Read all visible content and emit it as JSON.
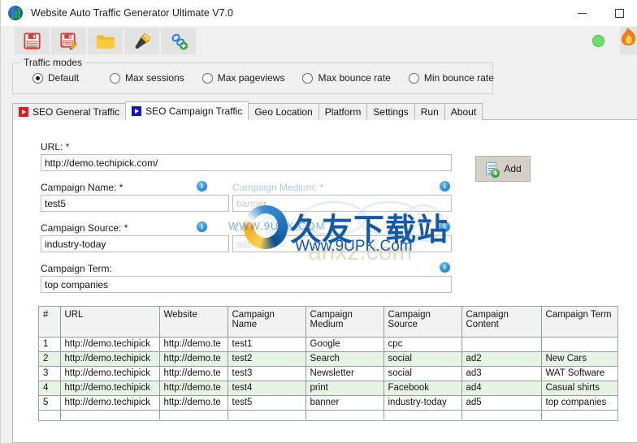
{
  "window": {
    "title": "Website Auto Traffic Generator Ultimate V7.0",
    "app_icon": "globe-chart-icon",
    "controls": {
      "minimize": "minimize-icon",
      "maximize": "maximize-icon"
    }
  },
  "toolbar": {
    "buttons": [
      {
        "name": "save-button",
        "icon": "floppy-disk-icon"
      },
      {
        "name": "save-as-button",
        "icon": "floppy-disk-edit-icon"
      },
      {
        "name": "open-button",
        "icon": "folder-icon"
      },
      {
        "name": "tools-button",
        "icon": "flashlight-icon"
      },
      {
        "name": "add-link-button",
        "icon": "link-add-icon"
      }
    ],
    "status_indicator": "green-status-dot",
    "status_color": "#6ede6e",
    "tray_icon": "orange-app-icon"
  },
  "traffic_modes": {
    "legend": "Traffic modes",
    "options": [
      {
        "label": "Default",
        "checked": true
      },
      {
        "label": "Max sessions",
        "checked": false
      },
      {
        "label": "Max pageviews",
        "checked": false
      },
      {
        "label": "Max bounce rate",
        "checked": false
      },
      {
        "label": "Min bounce rate",
        "checked": false
      }
    ]
  },
  "tabs": [
    {
      "label": "SEO General Traffic",
      "icon": "play-icon",
      "icon_color": "#e01b1b",
      "active": false
    },
    {
      "label": "SEO Campaign Traffic",
      "icon": "play-icon",
      "icon_color": "#1414c8",
      "active": true
    },
    {
      "label": "Geo Location",
      "active": false
    },
    {
      "label": "Platform",
      "active": false
    },
    {
      "label": "Settings",
      "active": false
    },
    {
      "label": "Run",
      "active": false
    },
    {
      "label": "About",
      "active": false
    }
  ],
  "form": {
    "url": {
      "label": "URL: *",
      "value": "http://demo.techipick.com/"
    },
    "campaign_name": {
      "label": "Campaign Name: *",
      "value": "test5",
      "info": "i"
    },
    "campaign_medium": {
      "label": "Campaign Medium: *",
      "value": "banner",
      "info": "i"
    },
    "campaign_source": {
      "label": "Campaign Source: *",
      "value": "industry-today",
      "info": "i"
    },
    "campaign_content": {
      "label": "Campaign Content:",
      "value": "ad5",
      "info": "i"
    },
    "campaign_term": {
      "label": "Campaign Term:",
      "value": "top companies",
      "info": "i"
    },
    "add_button": {
      "label": "Add",
      "icon": "document-add-icon"
    }
  },
  "watermark": {
    "chinese": "久友下载站",
    "url": "Www.9UPK.Com",
    "faint_left": "WWW.9UPK.COM",
    "faint_right": "anxz.com",
    "color": "#1558a8"
  },
  "grid": {
    "columns": [
      "#",
      "URL",
      "Website",
      "Campaign Name",
      "Campaign Medium",
      "Campaign Source",
      "Campaign Content",
      "Campaign Term"
    ],
    "rows": [
      {
        "num": "1",
        "url": "http://demo.techipick",
        "website": "http://demo.te",
        "campaign_name": "test1",
        "campaign_medium": "Google",
        "campaign_source": "cpc",
        "campaign_content": "",
        "campaign_term": ""
      },
      {
        "num": "2",
        "url": "http://demo.techipick",
        "website": "http://demo.te",
        "campaign_name": "test2",
        "campaign_medium": "Search",
        "campaign_source": "social",
        "campaign_content": "ad2",
        "campaign_term": "New Cars"
      },
      {
        "num": "3",
        "url": "http://demo.techipick",
        "website": "http://demo.te",
        "campaign_name": "test3",
        "campaign_medium": "Newsletter",
        "campaign_source": "social",
        "campaign_content": "ad3",
        "campaign_term": "WAT Software"
      },
      {
        "num": "4",
        "url": "http://demo.techipick",
        "website": "http://demo.te",
        "campaign_name": "test4",
        "campaign_medium": "print",
        "campaign_source": "Facebook",
        "campaign_content": "ad4",
        "campaign_term": "Casual shirts"
      },
      {
        "num": "5",
        "url": "http://demo.techipick",
        "website": "http://demo.te",
        "campaign_name": "test5",
        "campaign_medium": "banner",
        "campaign_source": "industry-today",
        "campaign_content": "ad5",
        "campaign_term": "top companies"
      }
    ]
  }
}
